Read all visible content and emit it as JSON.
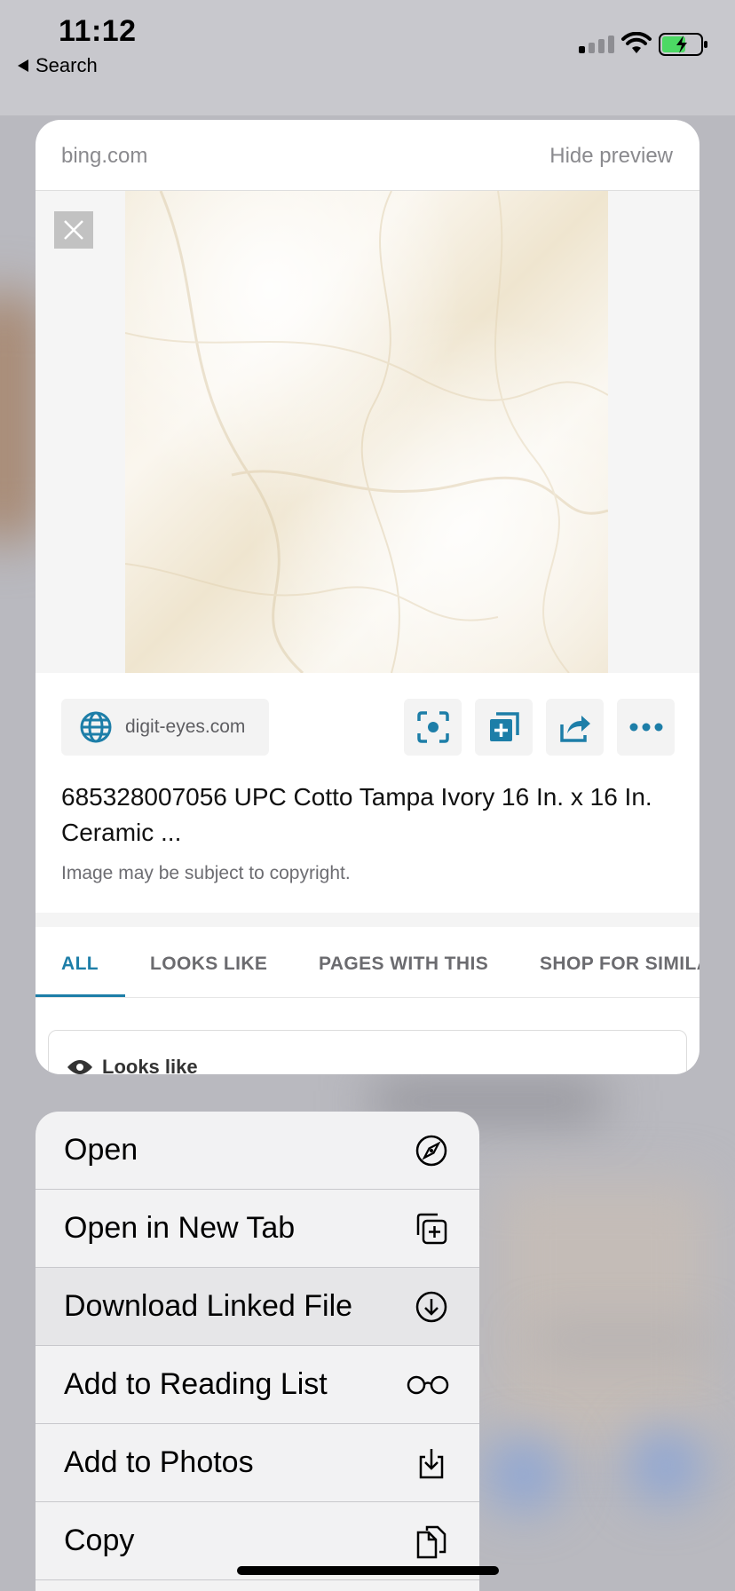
{
  "status_bar": {
    "time": "11:12",
    "back_label": "Search"
  },
  "preview": {
    "domain": "bing.com",
    "hide_label": "Hide preview",
    "source_site": "digit-eyes.com",
    "title": "685328007056 UPC Cotto Tampa Ivory 16 In. x 16 In. Ceramic ...",
    "copyright": "Image may be subject to copyright.",
    "tabs": [
      "ALL",
      "LOOKS LIKE",
      "PAGES WITH THIS",
      "SHOP FOR SIMILA"
    ],
    "section_label": "Looks like",
    "accent_color": "#1d7ea8"
  },
  "menu": {
    "items": [
      {
        "label": "Open",
        "icon": "compass-icon"
      },
      {
        "label": "Open in New Tab",
        "icon": "new-tab-icon"
      },
      {
        "label": "Download Linked File",
        "icon": "download-icon"
      },
      {
        "label": "Add to Reading List",
        "icon": "glasses-icon"
      },
      {
        "label": "Add to Photos",
        "icon": "save-photo-icon"
      },
      {
        "label": "Copy",
        "icon": "copy-icon"
      }
    ]
  }
}
